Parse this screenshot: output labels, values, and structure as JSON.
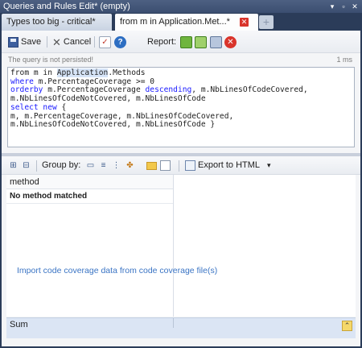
{
  "window": {
    "title": "Queries and Rules Edit* (empty)",
    "buttons": [
      "▾",
      "▫",
      "✕"
    ]
  },
  "tabs": [
    {
      "label": "Types too big - critical*",
      "active": false
    },
    {
      "label": "from m in Application.Met...*",
      "active": true
    }
  ],
  "toolbar": {
    "save_label": "Save",
    "cancel_label": "Cancel",
    "report_label": "Report:"
  },
  "status": {
    "message": "The query is not persisted!",
    "duration": "1 ms"
  },
  "editor": {
    "line1_a": "from m in ",
    "line1_b": "Application",
    "line1_c": ".Methods",
    "line2_kw": "where",
    "line2_rest": " m.PercentageCoverage >= 0",
    "line3_kw": "orderby",
    "line3_mid": " m.PercentageCoverage ",
    "line3_kw2": "descending",
    "line3_rest": ", m.NbLinesOfCodeCovered,",
    "line4": "m.NbLinesOfCodeNotCovered, m.NbLinesOfCode",
    "line5_kw": "select new",
    "line5_rest": " {",
    "line6": "m, m.PercentageCoverage, m.NbLinesOfCodeCovered,",
    "line7": "m.NbLinesOfCodeNotCovered, m.NbLinesOfCode }"
  },
  "results_toolbar": {
    "group_by_label": "Group by:",
    "export_label": "Export to HTML",
    "export_arrow": "▾"
  },
  "grid": {
    "column_header": "method",
    "empty_row": "No method matched",
    "import_link": "Import code coverage data from code coverage file(s)"
  },
  "sum": {
    "label": "Sum",
    "collapse_glyph": "⌃"
  },
  "colors": {
    "accent": "#3a74c4",
    "keyword": "#1a1aff",
    "close_red": "#d9342b"
  }
}
